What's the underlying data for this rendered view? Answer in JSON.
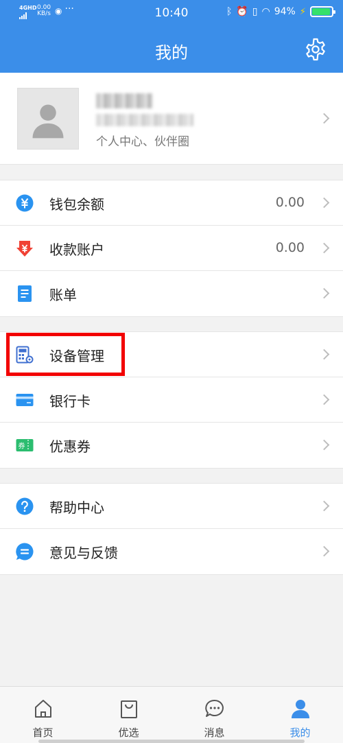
{
  "status_bar": {
    "network": "4GHD",
    "speed": "0.00",
    "speed_unit": "KB/s",
    "time": "10:40",
    "battery_percent": "94%",
    "battery_level": 0.94
  },
  "header": {
    "title": "我的",
    "settings_icon": "gear-icon"
  },
  "profile": {
    "avatar_icon": "person-silhouette-icon",
    "subtitle": "个人中心、伙伴圈"
  },
  "groups": [
    {
      "items": [
        {
          "icon": "wallet-yuan-icon",
          "label": "钱包余额",
          "value": "0.00"
        },
        {
          "icon": "collection-yuan-icon",
          "label": "收款账户",
          "value": "0.00"
        },
        {
          "icon": "bill-icon",
          "label": "账单"
        }
      ]
    },
    {
      "items": [
        {
          "icon": "device-manage-icon",
          "label": "设备管理"
        },
        {
          "icon": "bank-card-icon",
          "label": "银行卡"
        },
        {
          "icon": "coupon-icon",
          "label": "优惠券",
          "icon_text": "券"
        }
      ]
    },
    {
      "items": [
        {
          "icon": "help-icon",
          "label": "帮助中心"
        },
        {
          "icon": "feedback-icon",
          "label": "意见与反馈"
        }
      ]
    }
  ],
  "tabbar": {
    "tabs": [
      {
        "icon": "home-icon",
        "label": "首页"
      },
      {
        "icon": "shopping-bag-icon",
        "label": "优选"
      },
      {
        "icon": "message-icon",
        "label": "消息"
      },
      {
        "icon": "user-icon",
        "label": "我的",
        "active": true
      }
    ]
  },
  "colors": {
    "brand_blue": "#3b8ee9",
    "highlight_red": "#f20000",
    "coupon_green": "#2bbd6f",
    "wallet_blue": "#2a93f0",
    "collection_red": "#f04134"
  }
}
